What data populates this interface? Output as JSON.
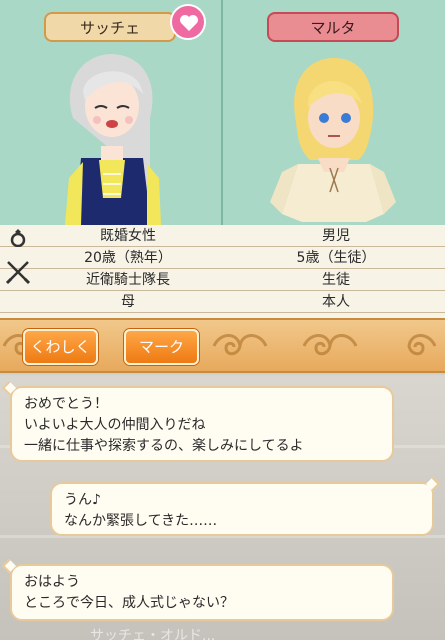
{
  "characters": {
    "left": {
      "name": "サッチェ",
      "heart_icon": "heart-icon"
    },
    "right": {
      "name": "マルタ"
    }
  },
  "info": {
    "rows": [
      {
        "icon": "ring-icon",
        "left": "既婚女性",
        "right": "男児"
      },
      {
        "icon": "crossed-swords-icon",
        "left": "20歳（熟年）",
        "right": "5歳（生徒）"
      },
      {
        "icon": "",
        "left": "近衛騎士隊長",
        "right": "生徒"
      },
      {
        "icon": "",
        "left": "母",
        "right": "本人"
      }
    ]
  },
  "actions": {
    "detail_label": "くわしく",
    "mark_label": "マーク"
  },
  "chat": {
    "messages": [
      {
        "lines": [
          "おめでとう！",
          "いよいよ大人の仲間入りだね",
          "一緒に仕事や探索するの、楽しみにしてるよ"
        ]
      },
      {
        "lines": [
          "うん♪",
          "なんか緊張してきた……"
        ]
      },
      {
        "lines": [
          "おはよう",
          "ところで今日、成人式じゃない？"
        ]
      }
    ],
    "faded_text": "サッチェ・オルド..."
  },
  "colors": {
    "portrait_bg": "#a9d8c6",
    "accent_orange": "#ee7a12",
    "heart_pink": "#f06aa2",
    "name_left_bg": "#f1d8a9",
    "name_right_bg": "#e98d92"
  }
}
